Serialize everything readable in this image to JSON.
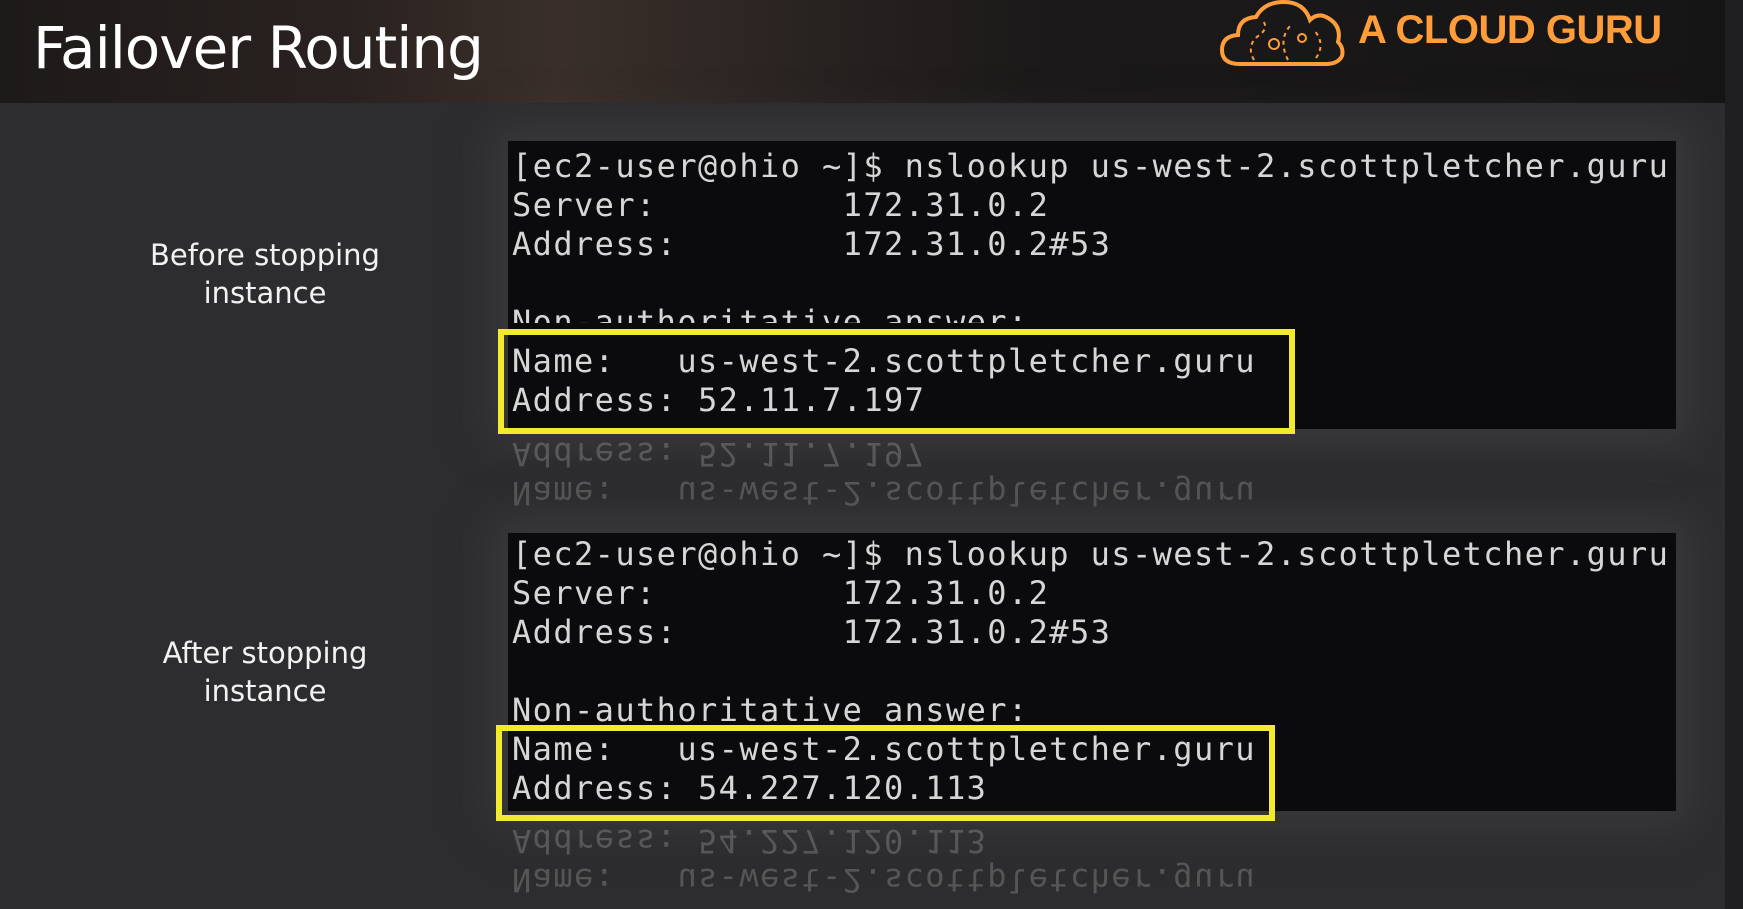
{
  "slide": {
    "title": "Failover Routing",
    "logo": {
      "text": "A CLOUD GURU",
      "icon": "cloud-icon",
      "color": "#ff9d3a"
    }
  },
  "sections": [
    {
      "caption": "Before stopping instance",
      "terminal": {
        "prompt_line": "[ec2-user@ohio ~]$ nslookup us-west-2.scottpletcher.guru",
        "server_line": "Server:         172.31.0.2",
        "address_line": "Address:        172.31.0.2#53",
        "answer_header": "Non-authoritative answer:",
        "name_line": "Name:   us-west-2.scottpletcher.guru",
        "result_line": "Address: 52.11.7.197"
      }
    },
    {
      "caption": "After stopping instance",
      "terminal": {
        "prompt_line": "[ec2-user@ohio ~]$ nslookup us-west-2.scottpletcher.guru",
        "server_line": "Server:         172.31.0.2",
        "address_line": "Address:        172.31.0.2#53",
        "answer_header": "Non-authoritative answer:",
        "name_line": "Name:   us-west-2.scottpletcher.guru",
        "result_line": "Address: 54.227.120.113"
      }
    }
  ],
  "colors": {
    "highlight": "#f1ea2e",
    "terminal_bg": "#0b0b0d",
    "terminal_text": "#d6d6d6"
  }
}
